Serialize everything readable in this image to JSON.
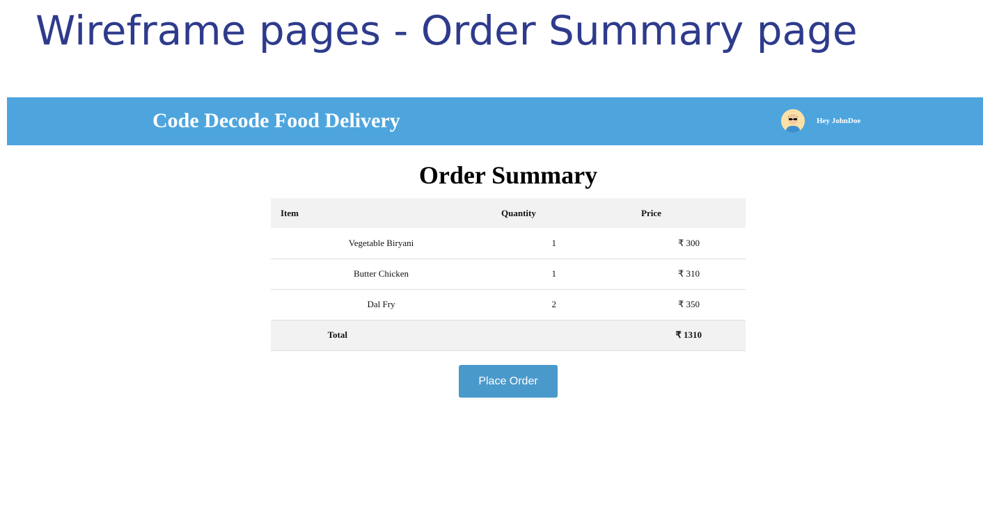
{
  "slide": {
    "title": "Wireframe pages - Order Summary page"
  },
  "navbar": {
    "brand": "Code Decode Food Delivery",
    "greeting": "Hey JohnDoe",
    "avatar_icon": "user-avatar-icon",
    "background_color": "#4ea5dd"
  },
  "main": {
    "heading": "Order Summary",
    "table": {
      "headers": [
        "Item",
        "Quantity",
        "Price"
      ],
      "rows": [
        {
          "item": "Vegetable Biryani",
          "quantity": "1",
          "price": "₹ 300"
        },
        {
          "item": "Butter Chicken",
          "quantity": "1",
          "price": "₹ 310"
        },
        {
          "item": "Dal Fry",
          "quantity": "2",
          "price": "₹ 350"
        }
      ],
      "total_label": "Total",
      "total_value": "₹ 1310"
    },
    "place_order_label": "Place Order",
    "button_color": "#4a99cb"
  }
}
